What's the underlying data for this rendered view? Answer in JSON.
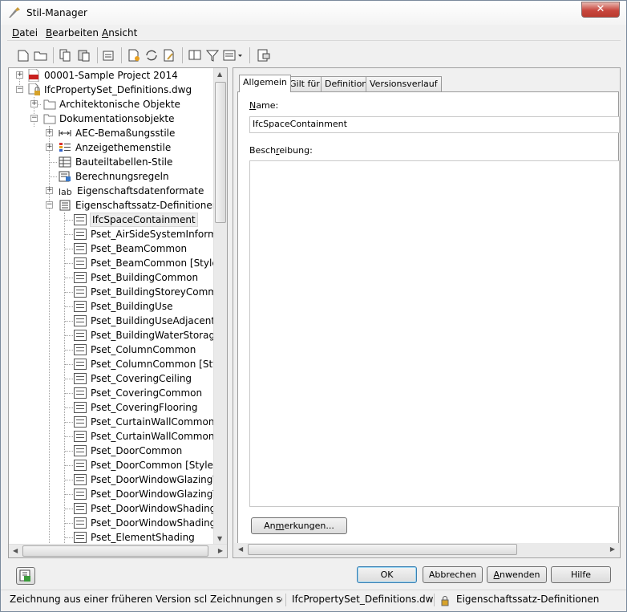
{
  "window": {
    "title": "Stil-Manager",
    "close_label": "✕"
  },
  "menu": [
    {
      "label": "Datei",
      "accel": "D",
      "rest": "atei"
    },
    {
      "label": "Bearbeiten",
      "accel": "B",
      "rest": "earbeiten"
    },
    {
      "label": "Ansicht",
      "accel": "A",
      "rest": "nsicht"
    }
  ],
  "tree": {
    "root1": "00001-Sample Project 2014",
    "root2": "IfcPropertySet_Definitions.dwg",
    "arch": "Architektonische Objekte",
    "dok": "Dokumentationsobjekte",
    "aec": "AEC-Bemaßungsstile",
    "anz": "Anzeigethemenstile",
    "bauteil": "Bauteiltabellen-Stile",
    "berech": "Berechnungsregeln",
    "eigfmt": "Eigenschaftsdatenformate",
    "eigdef": "Eigenschaftssatz-Definitionen",
    "items": [
      "IfcSpaceContainment",
      "Pset_AirSideSystemInformation",
      "Pset_BeamCommon",
      "Pset_BeamCommon [Style]",
      "Pset_BuildingCommon",
      "Pset_BuildingStoreyCommon",
      "Pset_BuildingUse",
      "Pset_BuildingUseAdjacent",
      "Pset_BuildingWaterStorage",
      "Pset_ColumnCommon",
      "Pset_ColumnCommon [Style]",
      "Pset_CoveringCeiling",
      "Pset_CoveringCommon",
      "Pset_CoveringFlooring",
      "Pset_CurtainWallCommon",
      "Pset_CurtainWallCommon [Style]",
      "Pset_DoorCommon",
      "Pset_DoorCommon [Style]",
      "Pset_DoorWindowGlazingType",
      "Pset_DoorWindowGlazingType",
      "Pset_DoorWindowShadingType",
      "Pset_DoorWindowShadingType",
      "Pset_ElementShading"
    ]
  },
  "tabs": [
    "Allgemein",
    "Gilt für",
    "Definition",
    "Versionsverlauf"
  ],
  "form": {
    "name_label": "Name:",
    "name_value": "IfcSpaceContainment",
    "desc_label": "Beschreibung:",
    "notes_button": "Anmerkungen..."
  },
  "buttons": {
    "ok": "OK",
    "cancel": "Abbrechen",
    "apply": "Anwenden",
    "help": "Hilfe"
  },
  "status": {
    "left": "Zeichnung aus einer früheren Version scl Zeichnungen sortiert",
    "file": "IfcPropertySet_Definitions.dwg",
    "category": "Eigenschaftssatz-Definitionen"
  },
  "colors": {
    "pdf_red": "#c8201e",
    "selection": "#ececec",
    "lock_gold": "#d6a22a"
  }
}
